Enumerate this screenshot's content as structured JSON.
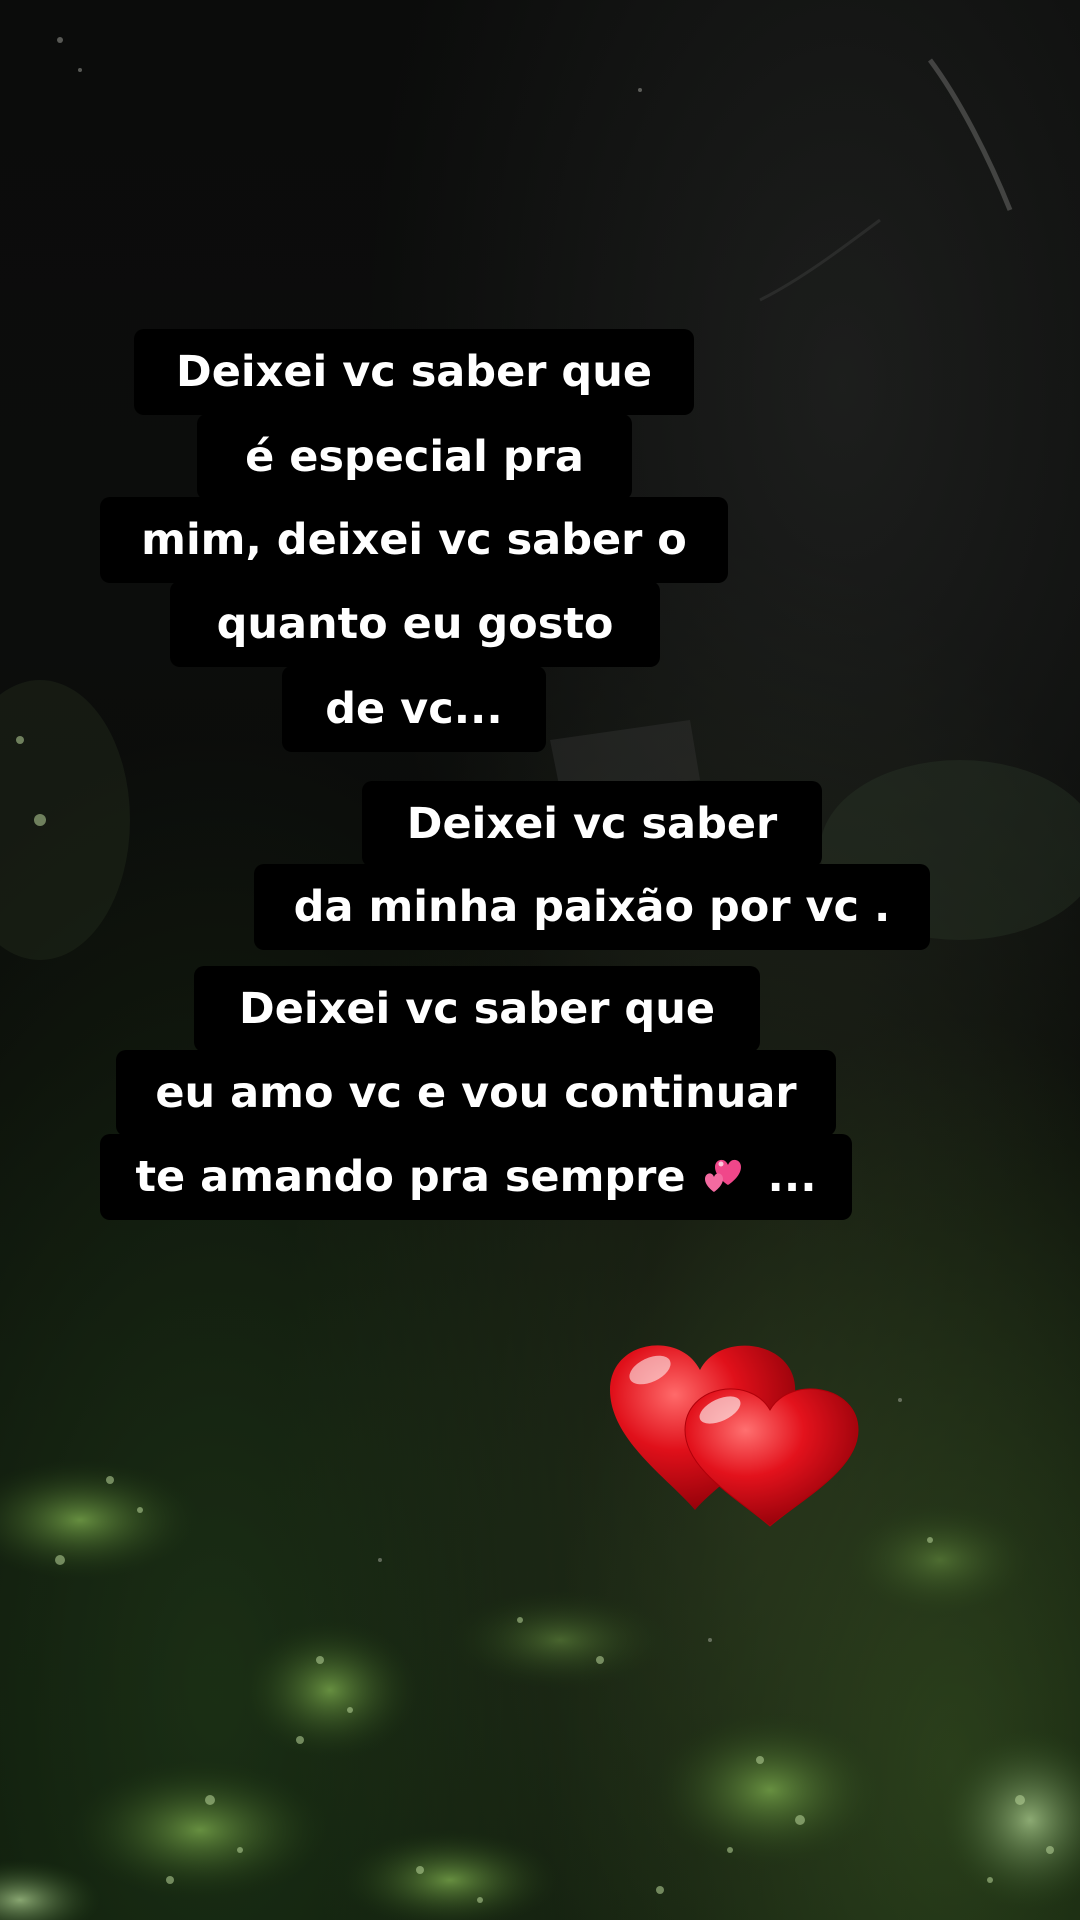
{
  "caption_groups": [
    {
      "lines": [
        "Deixei vc saber que",
        "é especial pra",
        "mim, deixei vc saber o",
        "quanto eu gosto",
        "de vc..."
      ]
    },
    {
      "lines": [
        "Deixei vc saber",
        "da minha paixão por vc ."
      ]
    },
    {
      "lines": [
        "Deixei vc saber que",
        "eu amo vc e vou continuar",
        "te amando pra sempre",
        "..."
      ]
    }
  ],
  "icons": {
    "inline_emoji": "two-hearts-icon",
    "sticker": "two-red-hearts-icon"
  },
  "colors": {
    "text": "#ffffff",
    "caption_box": "#000000",
    "heart_red": "#e0101a",
    "emoji_pink": "#f0478a"
  }
}
